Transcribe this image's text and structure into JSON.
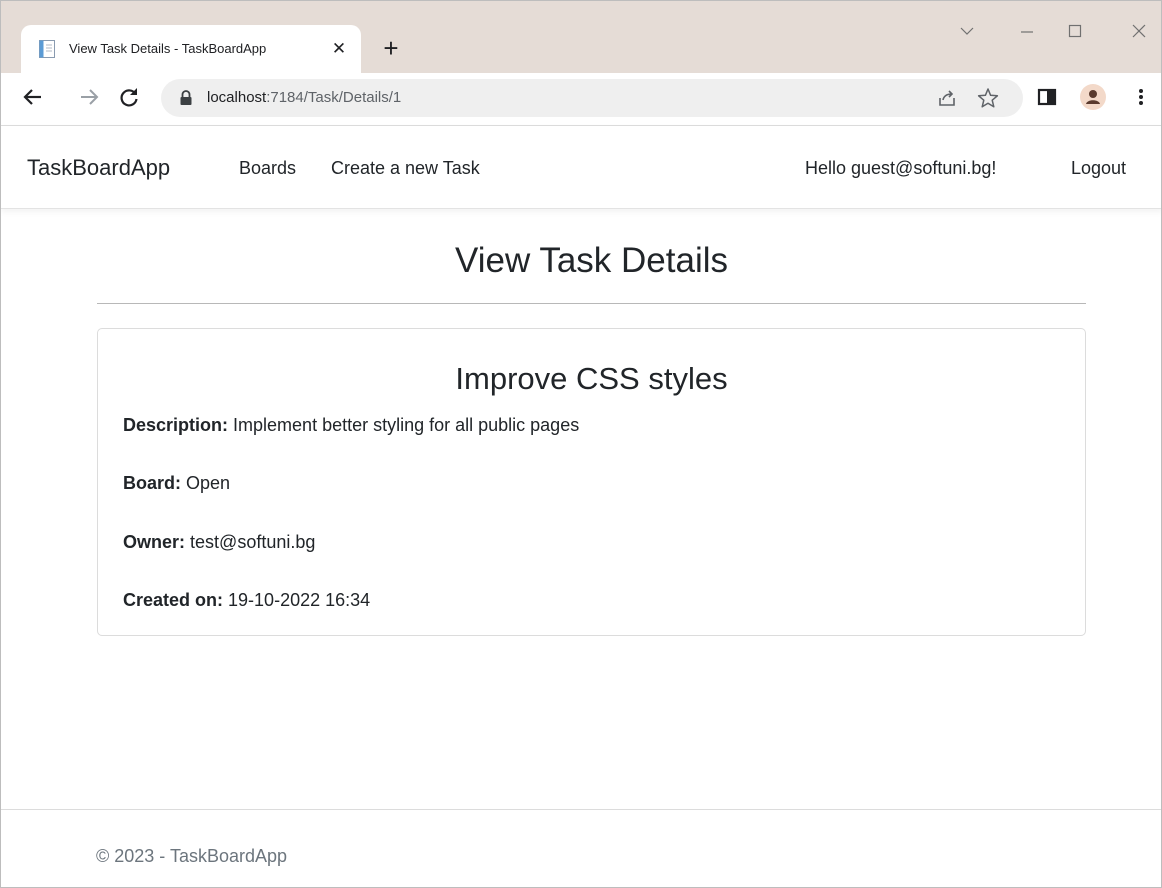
{
  "browser": {
    "tab": {
      "title": "View Task Details - TaskBoardApp",
      "close_glyph": "✕",
      "favicon": "document-icon"
    },
    "new_tab_glyph": "+",
    "window_controls": [
      "menu-chevron-icon",
      "minimize-icon",
      "maximize-icon",
      "close-icon"
    ],
    "toolbar": {
      "url_host": "localhost",
      "url_path": ":7184/Task/Details/1",
      "icons": [
        "back-arrow-icon",
        "forward-arrow-icon",
        "reload-icon",
        "lock-icon",
        "share-icon",
        "star-icon",
        "side-panel-icon",
        "avatar-icon",
        "kebab-menu-icon"
      ]
    }
  },
  "navbar": {
    "brand": "TaskBoardApp",
    "links": {
      "boards": "Boards",
      "create": "Create a new Task"
    },
    "greeting": "Hello guest@softuni.bg!",
    "logout": "Logout"
  },
  "main": {
    "page_title": "View Task Details",
    "task": {
      "title": "Improve CSS styles",
      "description_label": "Description:",
      "description": "Implement better styling for all public pages",
      "board_label": "Board:",
      "board": "Open",
      "owner_label": "Owner:",
      "owner": "test@softuni.bg",
      "created_label": "Created on:",
      "created": "19-10-2022 16:34"
    }
  },
  "footer": {
    "text": "© 2023 - TaskBoardApp"
  },
  "colors": {
    "tabstrip_bg": "#e5dcd6",
    "omnibox_bg": "#efefef",
    "text": "#212529",
    "muted": "#6c757d"
  }
}
